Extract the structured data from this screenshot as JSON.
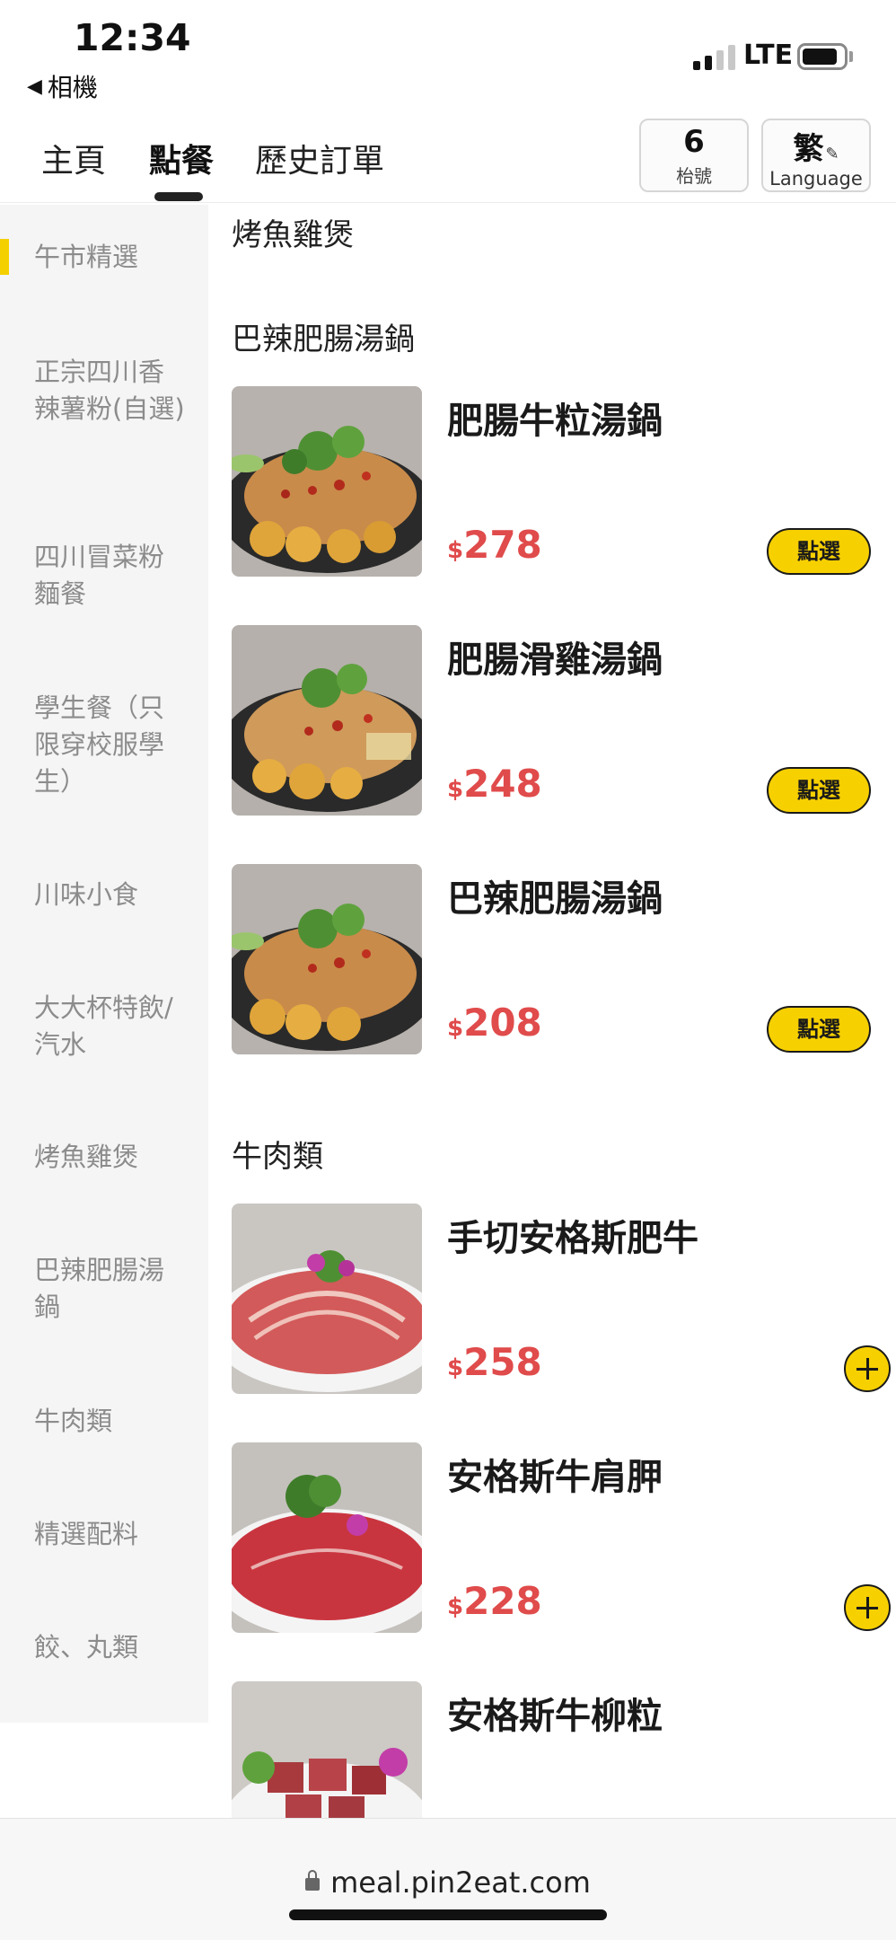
{
  "status_bar": {
    "time": "12:34",
    "back_label": "相機",
    "network": "LTE"
  },
  "nav": {
    "tabs": [
      {
        "label": "主頁"
      },
      {
        "label": "點餐"
      },
      {
        "label": "歷史訂單"
      }
    ],
    "active_tab": "點餐",
    "table_number": "6",
    "table_label": "枱號",
    "language_char": "繁",
    "language_label": "Language"
  },
  "sidebar": {
    "active": "午市精選",
    "categories": [
      {
        "label": "午市精選"
      },
      {
        "label": "正宗四川香辣薯粉(自選)"
      },
      {
        "label": "四川冒菜粉麵餐"
      },
      {
        "label": "學生餐（只限穿校服學生）"
      },
      {
        "label": "川味小食"
      },
      {
        "label": "大大杯特飲/汽水"
      },
      {
        "label": "烤魚雞煲"
      },
      {
        "label": "巴辣肥腸湯鍋"
      },
      {
        "label": "牛肉類"
      },
      {
        "label": "精選配料"
      },
      {
        "label": "餃、丸類"
      }
    ]
  },
  "sections": [
    {
      "title": "烤魚雞煲"
    },
    {
      "title": "巴辣肥腸湯鍋"
    },
    {
      "title": "牛肉類"
    }
  ],
  "items": [
    {
      "name": "肥腸牛粒湯鍋",
      "currency": "$",
      "price": "278",
      "button": "點選"
    },
    {
      "name": "肥腸滑雞湯鍋",
      "currency": "$",
      "price": "248",
      "button": "點選"
    },
    {
      "name": "巴辣肥腸湯鍋",
      "currency": "$",
      "price": "208",
      "button": "點選"
    },
    {
      "name": "手切安格斯肥牛",
      "currency": "$",
      "price": "258"
    },
    {
      "name": "安格斯牛肩胛",
      "currency": "$",
      "price": "228"
    },
    {
      "name": "安格斯牛柳粒"
    }
  ],
  "urlbar": {
    "url": "meal.pin2eat.com"
  },
  "colors": {
    "accent_yellow": "#f7d000",
    "price_red": "#e04b4b",
    "sidebar_bg": "#f5f5f5"
  }
}
